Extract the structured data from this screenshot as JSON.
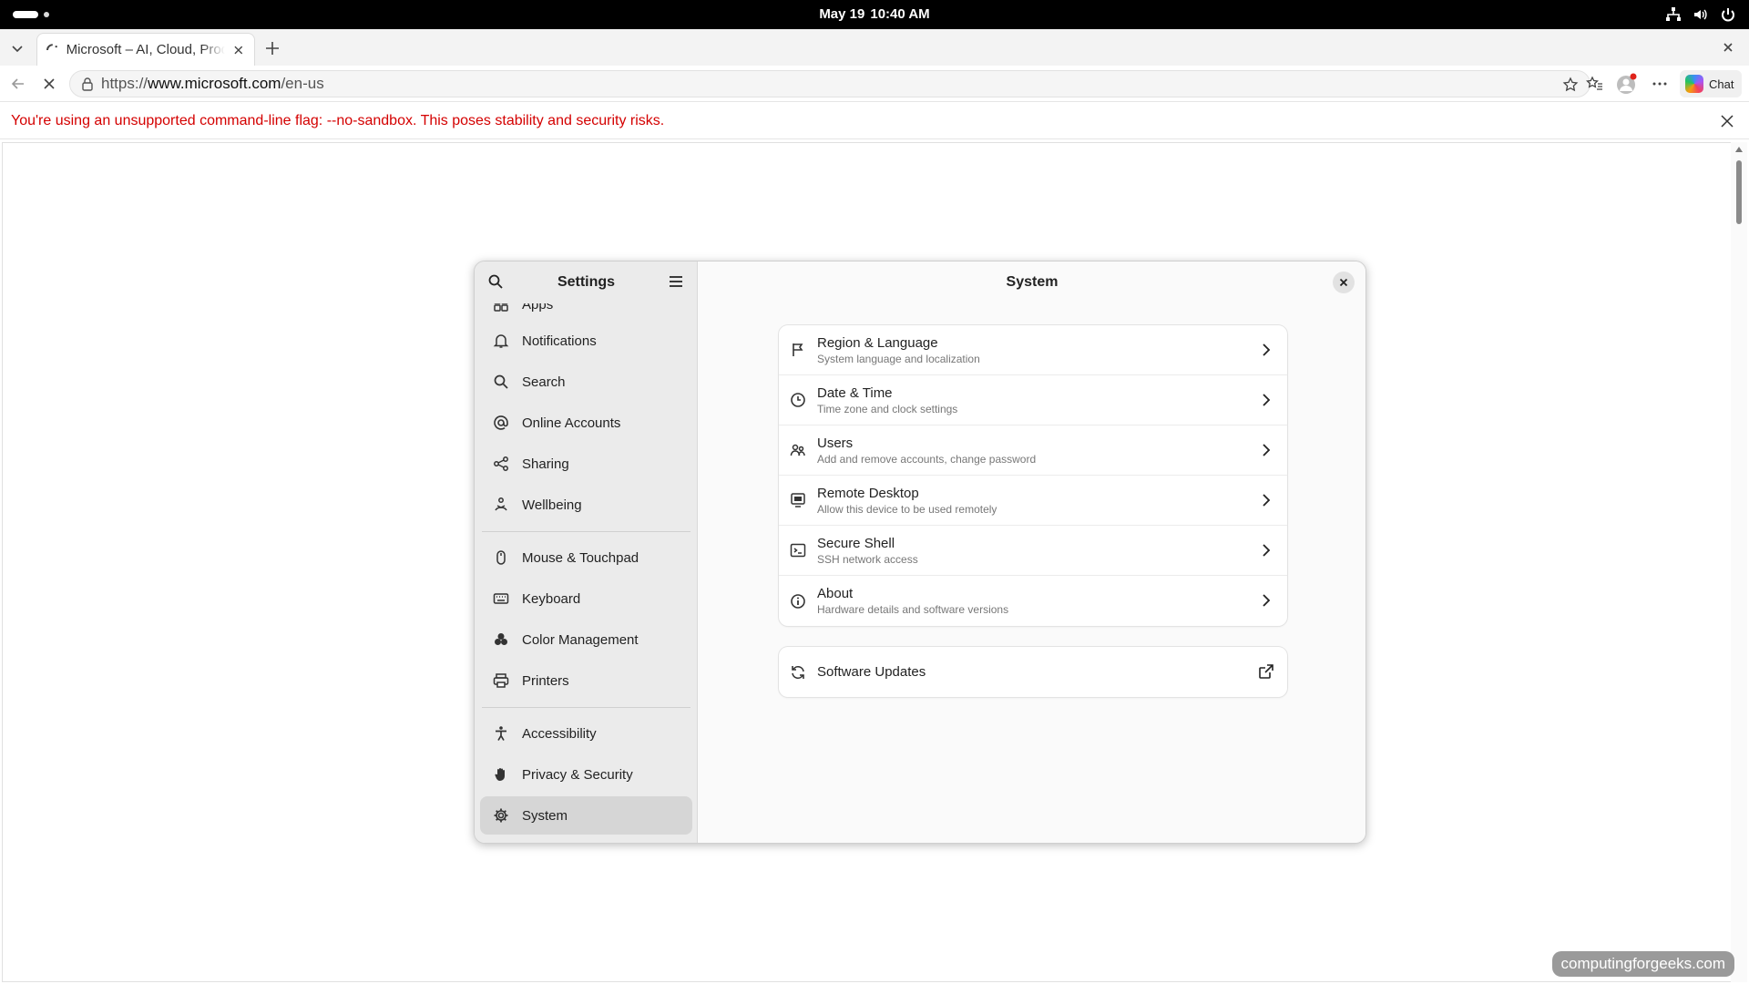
{
  "topbar": {
    "date": "May 19",
    "time": "10:40 AM"
  },
  "browser": {
    "tab_title": "Microsoft – AI, Cloud, Productivity",
    "url_prefix": "https://",
    "url_host": "www.microsoft.com",
    "url_path": "/en-us",
    "chat_label": "Chat",
    "warning": "You're using an unsupported command-line flag: --no-sandbox. This poses stability and security risks."
  },
  "settings": {
    "sidebar_title": "Settings",
    "main_title": "System",
    "sidebar_items": [
      {
        "label": "Apps",
        "icon": "apps-icon"
      },
      {
        "label": "Notifications",
        "icon": "bell-icon"
      },
      {
        "label": "Search",
        "icon": "search-icon"
      },
      {
        "label": "Online Accounts",
        "icon": "at-icon"
      },
      {
        "label": "Sharing",
        "icon": "share-icon"
      },
      {
        "label": "Wellbeing",
        "icon": "wellbeing-icon"
      },
      {
        "label": "Mouse & Touchpad",
        "icon": "mouse-icon"
      },
      {
        "label": "Keyboard",
        "icon": "keyboard-icon"
      },
      {
        "label": "Color Management",
        "icon": "palette-icon"
      },
      {
        "label": "Printers",
        "icon": "printer-icon"
      },
      {
        "label": "Accessibility",
        "icon": "accessibility-icon"
      },
      {
        "label": "Privacy & Security",
        "icon": "hand-icon"
      },
      {
        "label": "System",
        "icon": "gear-icon"
      }
    ],
    "active_item": "System",
    "system_rows": [
      {
        "title": "Region & Language",
        "subtitle": "System language and localization",
        "icon": "flag-icon"
      },
      {
        "title": "Date & Time",
        "subtitle": "Time zone and clock settings",
        "icon": "clock-icon"
      },
      {
        "title": "Users",
        "subtitle": "Add and remove accounts, change password",
        "icon": "users-icon"
      },
      {
        "title": "Remote Desktop",
        "subtitle": "Allow this device to be used remotely",
        "icon": "remote-desktop-icon"
      },
      {
        "title": "Secure Shell",
        "subtitle": "SSH network access",
        "icon": "terminal-icon"
      },
      {
        "title": "About",
        "subtitle": "Hardware details and software versions",
        "icon": "info-icon"
      }
    ],
    "software_updates": "Software Updates"
  },
  "watermark": "computingforgeeks.com"
}
